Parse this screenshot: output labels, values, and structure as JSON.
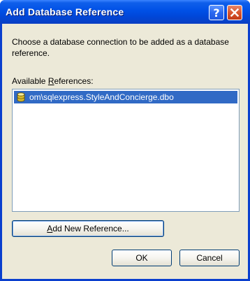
{
  "window": {
    "title": "Add Database Reference",
    "help_glyph": "?"
  },
  "dialog": {
    "description": "Choose a database connection to be added as a database reference.",
    "available_label_accel": "R",
    "available_label_pre": "Available ",
    "available_label_post": "eferences:",
    "references": [
      {
        "label": "om\\sqlexpress.StyleAndConcierge.dbo",
        "selected": true,
        "icon": "database-icon"
      }
    ],
    "add_button_accel": "A",
    "add_button_rest": "dd New Reference...",
    "ok_label": "OK",
    "cancel_label": "Cancel"
  },
  "colors": {
    "titlebar": "#0050e6",
    "client": "#ece9d8",
    "selection": "#316ac5",
    "close_button": "#d8562f"
  }
}
